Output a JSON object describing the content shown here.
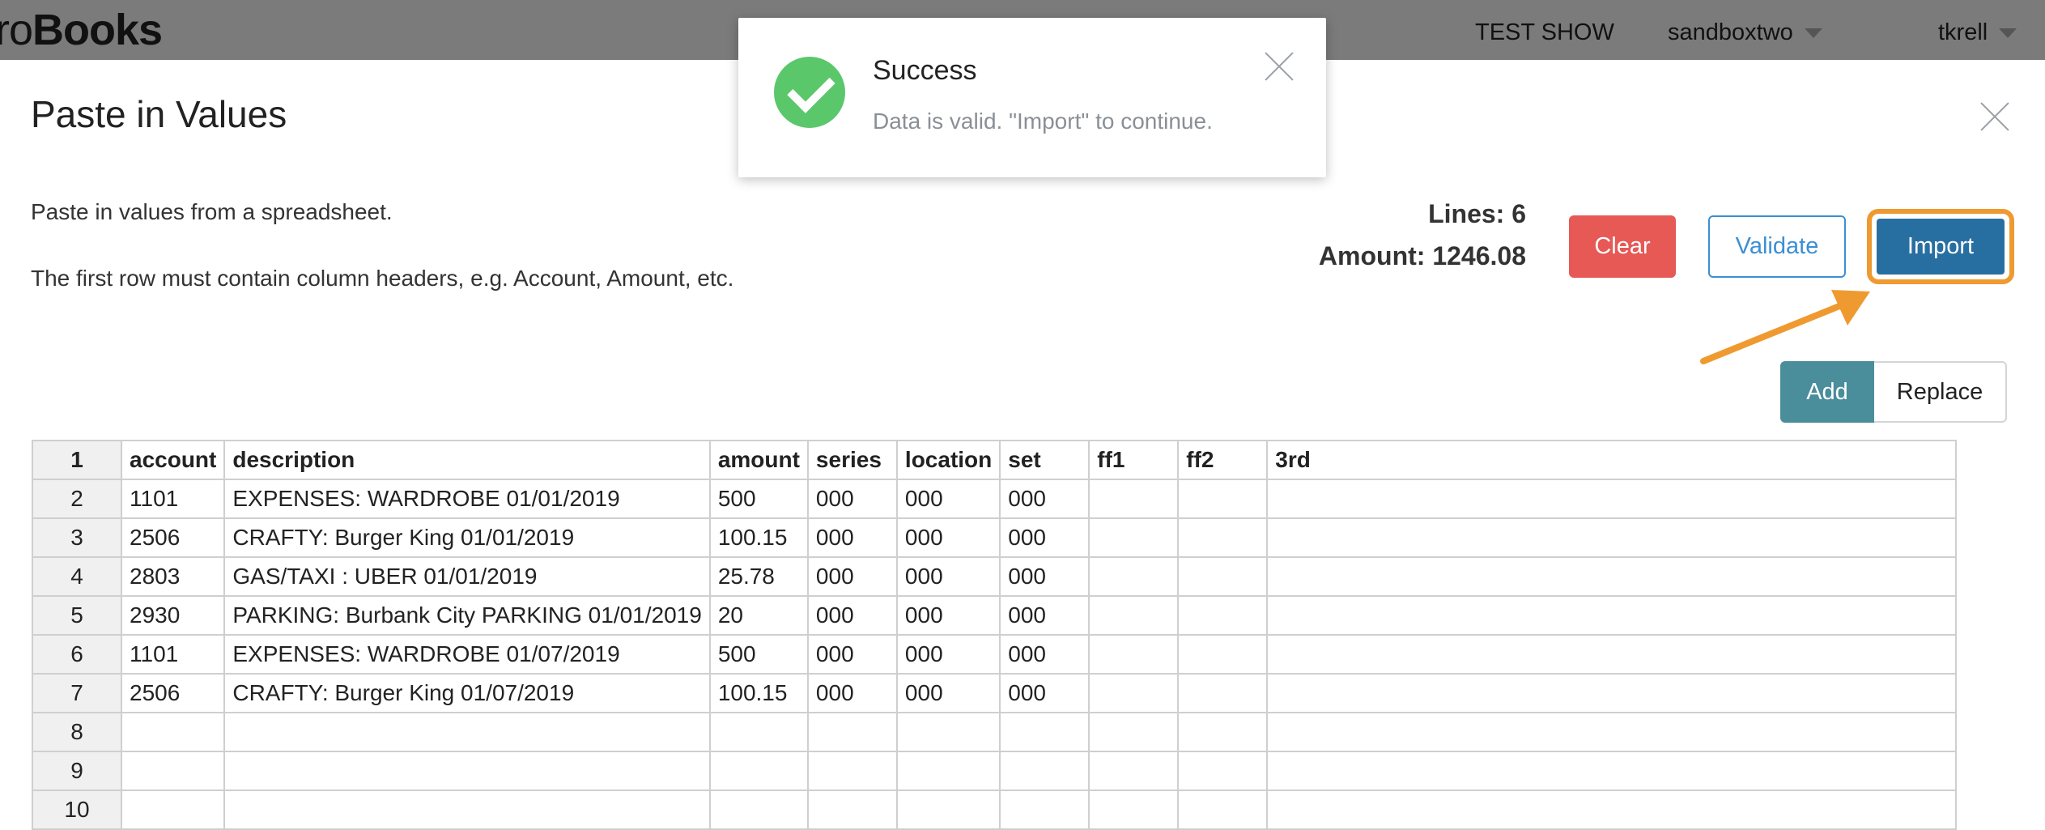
{
  "app": {
    "brand_prefix": "ro",
    "brand_bold": "Books",
    "show": "TEST SHOW",
    "environment": "sandboxtwo",
    "user": "tkrell"
  },
  "modal": {
    "title": "Paste in Values",
    "instruction_1": "Paste in values from a spreadsheet.",
    "instruction_2": "The first row must contain column headers, e.g. Account, Amount, etc.",
    "lines_label": "Lines: 6",
    "amount_label": "Amount: 1246.08",
    "buttons": {
      "clear": "Clear",
      "validate": "Validate",
      "import": "Import"
    },
    "mode": {
      "add": "Add",
      "replace": "Replace",
      "selected": "Add"
    }
  },
  "toast": {
    "title": "Success",
    "message": "Data is valid. \"Import\" to continue."
  },
  "colors": {
    "clear_button": "#e65955",
    "validate_button": "#3b8fd4",
    "import_button": "#286fa1",
    "highlight": "#ef9a30",
    "add_button": "#4a8d9b",
    "success": "#5bc76b"
  },
  "grid": {
    "row_numbers": [
      "1",
      "2",
      "3",
      "4",
      "5",
      "6",
      "7",
      "8",
      "9",
      "10"
    ],
    "headers": [
      "account",
      "description",
      "amount",
      "series",
      "location",
      "set",
      "ff1",
      "ff2",
      "3rd"
    ],
    "rows": [
      [
        "1101",
        "EXPENSES: WARDROBE 01/01/2019",
        "500",
        "000",
        "000",
        "000",
        "",
        "",
        ""
      ],
      [
        "2506",
        "CRAFTY: Burger King 01/01/2019",
        "100.15",
        "000",
        "000",
        "000",
        "",
        "",
        ""
      ],
      [
        "2803",
        "GAS/TAXI : UBER 01/01/2019",
        "25.78",
        "000",
        "000",
        "000",
        "",
        "",
        ""
      ],
      [
        "2930",
        "PARKING: Burbank City PARKING 01/01/2019",
        "20",
        "000",
        "000",
        "000",
        "",
        "",
        ""
      ],
      [
        "1101",
        "EXPENSES: WARDROBE 01/07/2019",
        "500",
        "000",
        "000",
        "000",
        "",
        "",
        ""
      ],
      [
        "2506",
        "CRAFTY: Burger King 01/07/2019",
        "100.15",
        "000",
        "000",
        "000",
        "",
        "",
        ""
      ],
      [
        "",
        "",
        "",
        "",
        "",
        "",
        "",
        "",
        ""
      ],
      [
        "",
        "",
        "",
        "",
        "",
        "",
        "",
        "",
        ""
      ],
      [
        "",
        "",
        "",
        "",
        "",
        "",
        "",
        "",
        ""
      ]
    ]
  }
}
